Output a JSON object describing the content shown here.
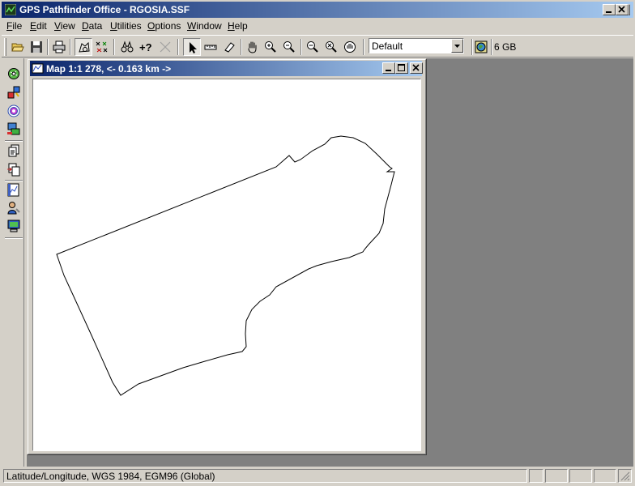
{
  "window": {
    "title": "GPS Pathfinder Office - RGOSIA.SSF"
  },
  "menu": {
    "items": [
      {
        "mnemonic": "F",
        "rest": "ile"
      },
      {
        "mnemonic": "E",
        "rest": "dit"
      },
      {
        "mnemonic": "V",
        "rest": "iew"
      },
      {
        "mnemonic": "D",
        "rest": "ata"
      },
      {
        "mnemonic": "U",
        "rest": "tilities"
      },
      {
        "mnemonic": "O",
        "rest": "ptions"
      },
      {
        "mnemonic": "W",
        "rest": "indow"
      },
      {
        "mnemonic": "H",
        "rest": "elp"
      }
    ]
  },
  "toolbar": {
    "layer_combo": {
      "value": "Default"
    },
    "storage_label": "6 GB",
    "query_label": "+?"
  },
  "map_window": {
    "title": "Map 1:1 278, <- 0.163 km ->"
  },
  "statusbar": {
    "coordinate_system": "Latitude/Longitude, WGS 1984, EGM96 (Global)"
  },
  "colors": {
    "titlebar_start": "#0a246a",
    "titlebar_end": "#a6caf0",
    "face": "#d4d0c8",
    "mdi_background": "#808080"
  }
}
